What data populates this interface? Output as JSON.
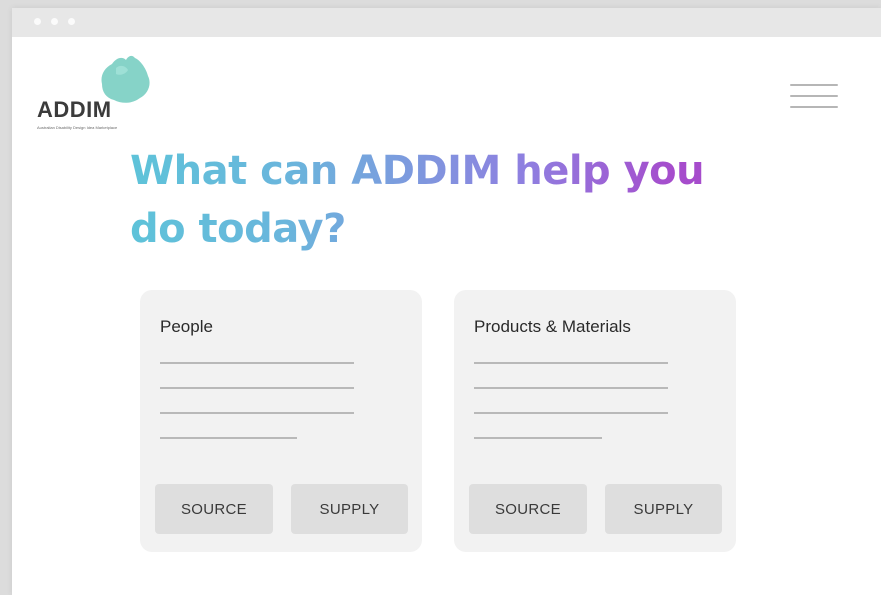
{
  "window": {
    "controls": [
      "dot",
      "dot",
      "dot"
    ]
  },
  "logo": {
    "text": "ADDIM",
    "tagline": "Australian Disability Design Idea Marketplace",
    "mark_color": "#86d3c8"
  },
  "header": {
    "menu_icon": "hamburger-menu-icon"
  },
  "hero": {
    "headline": "What can ADDIM help you do today?",
    "gradient_colors": [
      "#5ec3d9",
      "#8f7fe0",
      "#a64ccc"
    ]
  },
  "cards": [
    {
      "title": "People",
      "source_label": "SOURCE",
      "supply_label": "SUPPLY"
    },
    {
      "title": "Products & Materials",
      "source_label": "SOURCE",
      "supply_label": "SUPPLY"
    }
  ],
  "colors": {
    "card_bg": "#f2f2f2",
    "button_bg": "#dedede",
    "titlebar_bg": "#e7e7e7"
  }
}
